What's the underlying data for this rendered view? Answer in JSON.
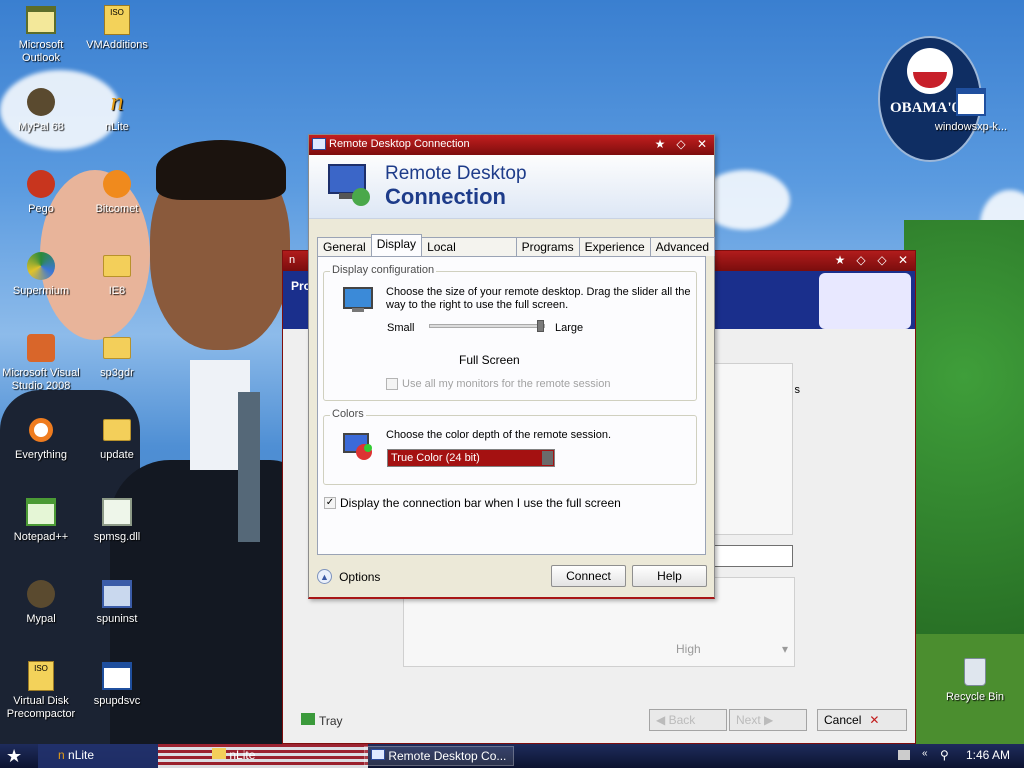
{
  "desktop": {
    "icons_left": [
      {
        "label": "Microsoft Outlook",
        "icon": "outlook-icon"
      },
      {
        "label": "MyPal 68",
        "icon": "mypal-icon"
      },
      {
        "label": "Pego",
        "icon": "pego-icon"
      },
      {
        "label": "Supermium",
        "icon": "supermium-icon"
      },
      {
        "label": "Microsoft Visual Studio 2008",
        "icon": "visual-studio-icon"
      },
      {
        "label": "Everything",
        "icon": "everything-icon"
      },
      {
        "label": "Notepad++",
        "icon": "notepadpp-icon"
      },
      {
        "label": "Mypal",
        "icon": "mypal-icon"
      },
      {
        "label": "Virtual Disk Precompactor",
        "icon": "iso-icon"
      }
    ],
    "icons_right": [
      {
        "label": "VMAdditions",
        "icon": "iso-icon"
      },
      {
        "label": "nLite",
        "icon": "nlite-icon"
      },
      {
        "label": "Bitcomet",
        "icon": "bitcomet-icon"
      },
      {
        "label": "IE8",
        "icon": "folder-icon"
      },
      {
        "label": "sp3gdr",
        "icon": "folder-icon"
      },
      {
        "label": "update",
        "icon": "folder-icon"
      },
      {
        "label": "spmsg.dll",
        "icon": "dll-icon"
      },
      {
        "label": "spuninst",
        "icon": "installer-icon"
      },
      {
        "label": "spupdsvc",
        "icon": "window-icon"
      }
    ],
    "top_right_icon": "windowsxp-k...",
    "recycle_bin": "Recycle Bin",
    "wallpaper_logo": "OBAMA'0X"
  },
  "nlite_window": {
    "title": "n",
    "header_text": "Pro",
    "partial_row_text": "s",
    "dropdown_value": "High",
    "tray_label": "Tray",
    "back_label": "Back",
    "next_label": "Next",
    "cancel_label": "Cancel"
  },
  "rdc": {
    "title": "Remote Desktop Connection",
    "banner_line1": "Remote Desktop",
    "banner_line2": "Connection",
    "tabs": [
      "General",
      "Display",
      "Local Resources",
      "Programs",
      "Experience",
      "Advanced"
    ],
    "active_tab": "Display",
    "display_config": {
      "label": "Display configuration",
      "description": "Choose the size of your remote desktop. Drag the slider all the way to the right to use the full screen.",
      "small": "Small",
      "large": "Large",
      "slider_level": 1.0,
      "current": "Full Screen",
      "monitors_label": "Use all my monitors for the remote session"
    },
    "colors": {
      "label": "Colors",
      "description": "Choose the color depth of the remote session.",
      "selected": "True Color (24 bit)"
    },
    "connection_bar_label": "Display the connection bar when I use the full screen",
    "connection_bar_checked": true,
    "options_label": "Options",
    "connect_label": "Connect",
    "help_label": "Help"
  },
  "taskbar": {
    "items": [
      "nLite",
      "nLite",
      "Remote Desktop Co..."
    ],
    "time": "1:46 AM"
  },
  "colors": {
    "titlebar": "#a81616",
    "taskbar": "#0c1330"
  }
}
